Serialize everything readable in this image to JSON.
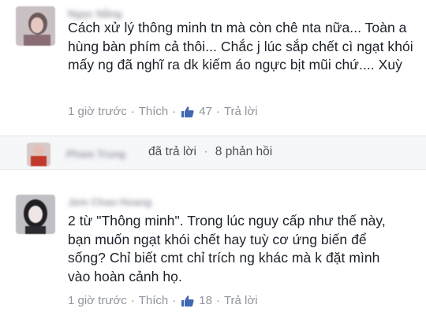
{
  "comments": [
    {
      "author": "Ngọc Nắng",
      "text": "Cách xử lý thông minh tn mà còn chê nta nữa... Toàn a hùng bàn phím cả thôi... Chắc j lúc sắp chết cì ngạt khói mấy ng đã nghĩ ra dk kiếm áo ngực bịt mũi chứ.... Xuỳ",
      "time": "1 giờ trước",
      "like_label": "Thích",
      "like_count": "47",
      "reply_label": "Trả lời"
    },
    {
      "author": "Jem Chao Hoang",
      "text": "2 từ \"Thông minh\". Trong lúc nguy cấp như thế này, bạn muốn ngạt khói chết hay tuỳ cơ ứng biến để sống? Chỉ biết cmt chỉ trích ng khác mà k đặt mình vào hoàn cảnh họ.",
      "time": "1 giờ trước",
      "like_label": "Thích",
      "like_count": "18",
      "reply_label": "Trả lời"
    }
  ],
  "reply_summary": {
    "author": "Pham Trung",
    "action": "đã trả lời",
    "count": "8 phản hồi"
  },
  "icons": {
    "like": "thumbs-up-icon"
  },
  "colors": {
    "text": "#1d2129",
    "meta": "#90949c",
    "like_blue": "#4267b2"
  }
}
